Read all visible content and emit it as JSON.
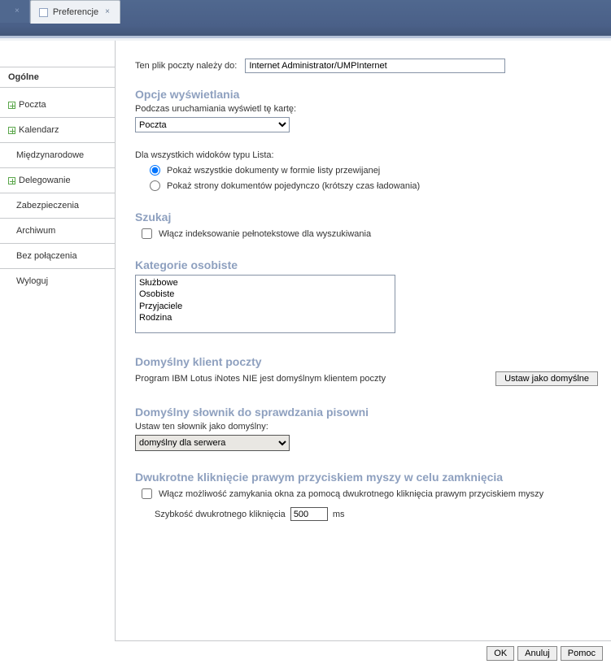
{
  "tabs": {
    "prev_close_visible": "×",
    "active_label": "Preferencje",
    "active_close": "×"
  },
  "sidebar": {
    "title": "Ogólne",
    "items": [
      {
        "label": "Poczta",
        "icon": true,
        "indent": false
      },
      {
        "label": "Kalendarz",
        "icon": true,
        "indent": false
      },
      {
        "label": "Międzynarodowe",
        "icon": false,
        "indent": true
      },
      {
        "label": "Delegowanie",
        "icon": true,
        "indent": false
      },
      {
        "label": "Zabezpieczenia",
        "icon": false,
        "indent": true
      },
      {
        "label": "Archiwum",
        "icon": false,
        "indent": true
      },
      {
        "label": "Bez połączenia",
        "icon": false,
        "indent": true
      },
      {
        "label": "Wyloguj",
        "icon": false,
        "indent": true
      }
    ]
  },
  "owner": {
    "label": "Ten plik poczty należy do:",
    "value": "Internet Administrator/UMPInternet"
  },
  "display": {
    "heading": "Opcje wyświetlania",
    "start_tab_label": "Podczas uruchamiania wyświetl tę kartę:",
    "start_tab_value": "Poczta",
    "list_views_label": "Dla wszystkich widoków typu Lista:",
    "radio_all": "Pokaż wszystkie dokumenty w formie listy przewijanej",
    "radio_pages": "Pokaż strony dokumentów pojedynczo (krótszy czas ładowania)"
  },
  "search": {
    "heading": "Szukaj",
    "fulltext_label": "Włącz indeksowanie pełnotekstowe dla wyszukiwania"
  },
  "categories": {
    "heading": "Kategorie osobiste",
    "value": "Służbowe\nOsobiste\nPrzyjaciele\nRodzina"
  },
  "defmail": {
    "heading": "Domyślny klient poczty",
    "status": "Program IBM Lotus iNotes NIE jest domyślnym klientem poczty",
    "button": "Ustaw jako domyślne"
  },
  "dict": {
    "heading": "Domyślny słownik do sprawdzania pisowni",
    "label": "Ustaw ten słownik jako domyślny:",
    "value": "domyślny dla serwera"
  },
  "dblclick": {
    "heading": "Dwukrotne kliknięcie prawym przyciskiem myszy w celu zamknięcia",
    "enable_label": "Włącz możliwość zamykania okna za pomocą dwukrotnego kliknięcia prawym przyciskiem myszy",
    "speed_label": "Szybkość dwukrotnego kliknięcia",
    "speed_value": "500",
    "speed_unit": "ms"
  },
  "footer": {
    "ok": "OK",
    "cancel": "Anuluj",
    "help": "Pomoc"
  }
}
